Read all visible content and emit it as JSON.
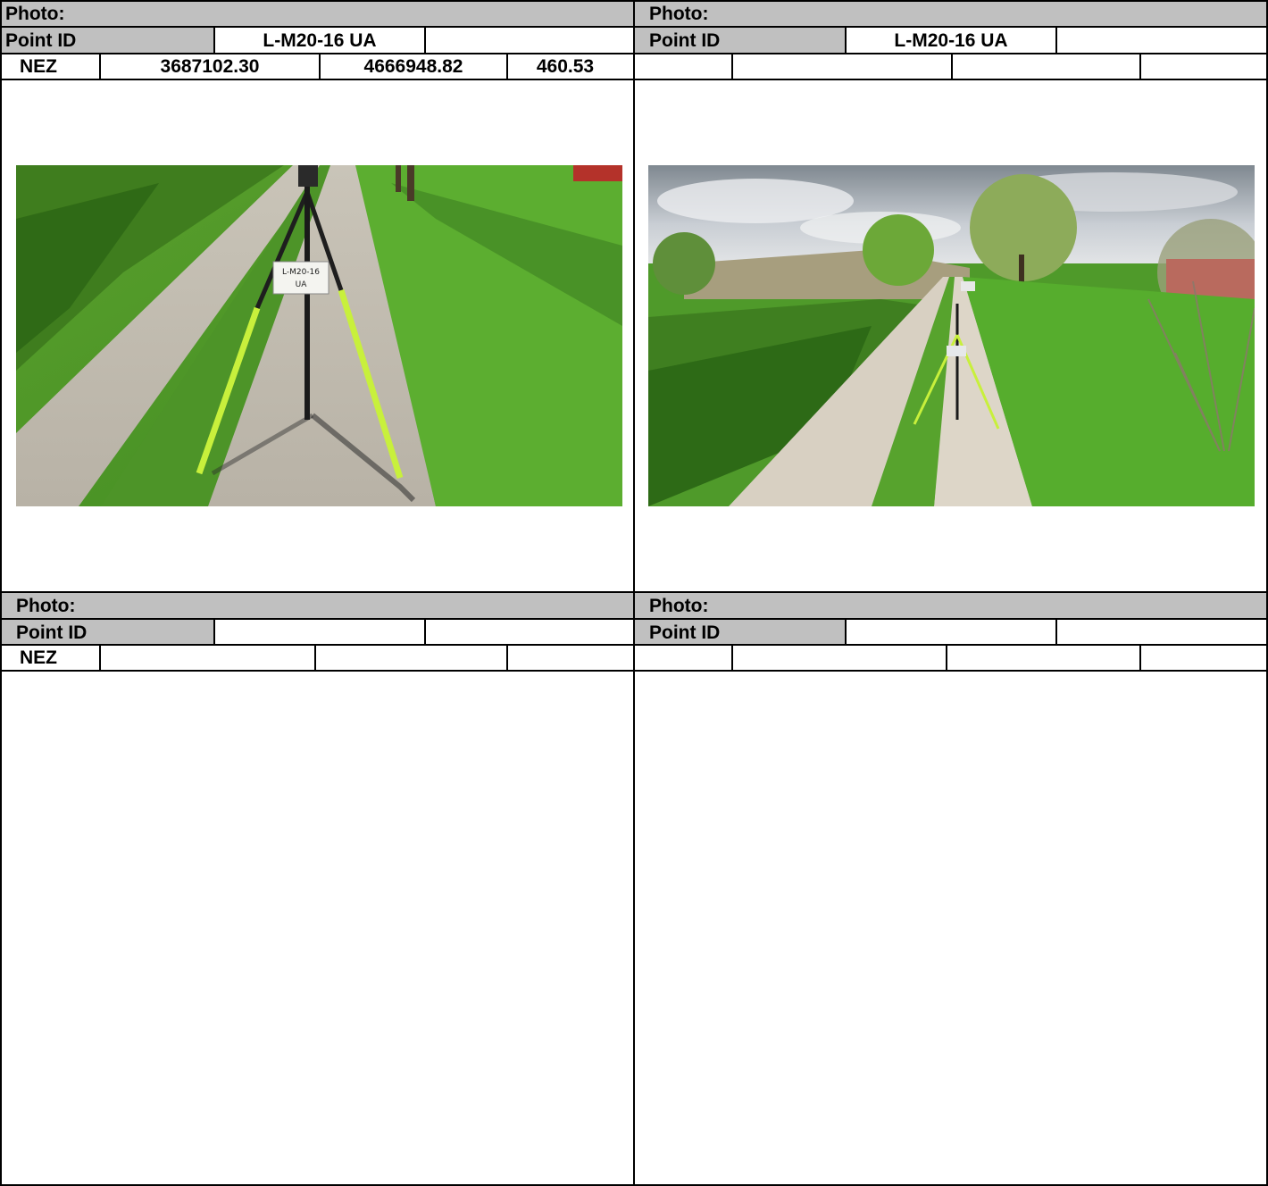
{
  "panels": [
    {
      "photo_label": "Photo:",
      "point_id_label": "Point ID",
      "point_id_value": "L-M20-16 UA",
      "nez_label": "NEZ",
      "northing": "3687102.30",
      "easting": "4666948.82",
      "elevation": "460.53",
      "sign_text_line1": "L-M20-16",
      "sign_text_line2": "UA"
    },
    {
      "photo_label": "Photo:",
      "point_id_label": "Point ID",
      "point_id_value": "L-M20-16 UA"
    },
    {
      "photo_label": "Photo:",
      "point_id_label": "Point ID",
      "nez_label": "NEZ"
    },
    {
      "photo_label": "Photo:",
      "point_id_label": "Point ID"
    }
  ],
  "colors": {
    "header_grey": "#c0c0c0",
    "grid_line": "#000000",
    "tripod_leg": "#c8f03c"
  }
}
